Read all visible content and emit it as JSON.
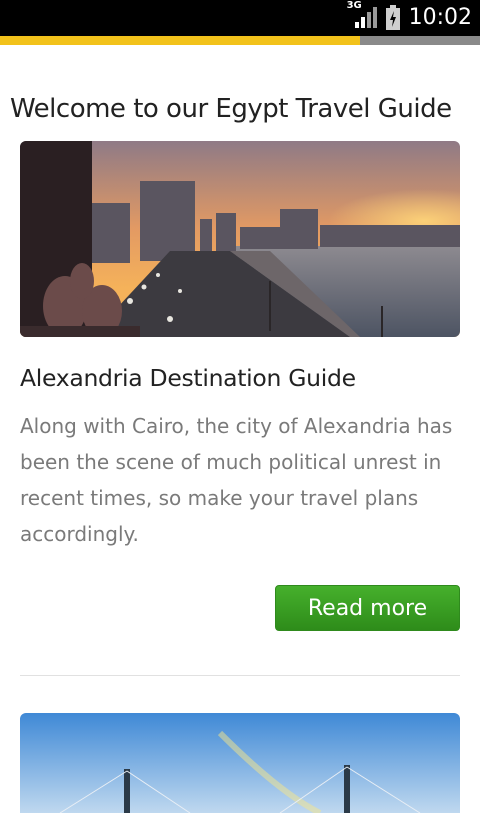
{
  "status_bar": {
    "network_label": "3G",
    "time": "10:02",
    "icons": [
      "signal-icon",
      "battery-charging-icon"
    ]
  },
  "progress": {
    "fraction": 0.75,
    "fill_color": "#f2c21b",
    "track_color": "#8a8a8a"
  },
  "page": {
    "title": "Welcome to our Egypt Travel Guide"
  },
  "articles": [
    {
      "title": "Alexandria Destination Guide",
      "excerpt": "Along with Cairo, the city of Alexandria has been the scene of much political unrest in recent times, so make your travel plans accordingly.",
      "button_label": "Read more"
    }
  ],
  "colors": {
    "button_green": "#3a9f24",
    "title_text": "#222222",
    "body_text": "#7a7a7a"
  }
}
